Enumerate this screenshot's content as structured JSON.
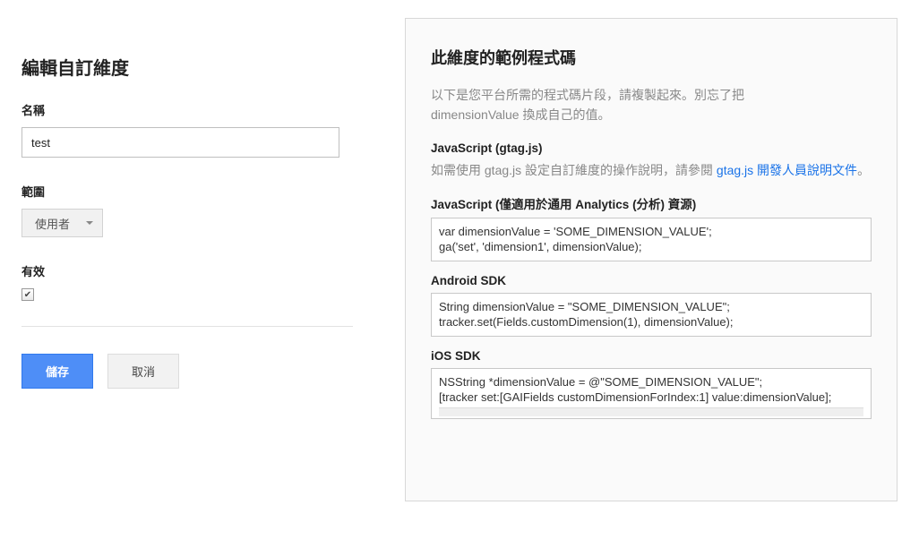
{
  "left": {
    "page_title": "編輯自訂維度",
    "name_label": "名稱",
    "name_value": "test",
    "scope_label": "範圍",
    "scope_value": "使用者",
    "active_label": "有效",
    "active_checked": true,
    "save_label": "儲存",
    "cancel_label": "取消"
  },
  "right": {
    "code_title": "此維度的範例程式碼",
    "intro_line1": "以下是您平台所需的程式碼片段，請複製起來。別忘了把",
    "intro_line2": "dimensionValue 換成自己的值。",
    "gtag": {
      "heading": "JavaScript (gtag.js)",
      "desc_prefix": "如需使用 gtag.js 設定自訂維度的操作說明，請參閱 ",
      "link_text": "gtag.js 開發人員說明文件",
      "desc_suffix": "。"
    },
    "ua": {
      "heading": "JavaScript (僅適用於通用 Analytics (分析) 資源)",
      "code_line1": "var dimensionValue = 'SOME_DIMENSION_VALUE';",
      "code_line2": "ga('set', 'dimension1', dimensionValue);"
    },
    "android": {
      "heading": "Android SDK",
      "code_line1": "String dimensionValue = \"SOME_DIMENSION_VALUE\";",
      "code_line2": "tracker.set(Fields.customDimension(1), dimensionValue);"
    },
    "ios": {
      "heading": "iOS SDK",
      "code_line1": "NSString *dimensionValue = @\"SOME_DIMENSION_VALUE\";",
      "code_line2": "[tracker set:[GAIFields customDimensionForIndex:1] value:dimensionValue];"
    }
  }
}
